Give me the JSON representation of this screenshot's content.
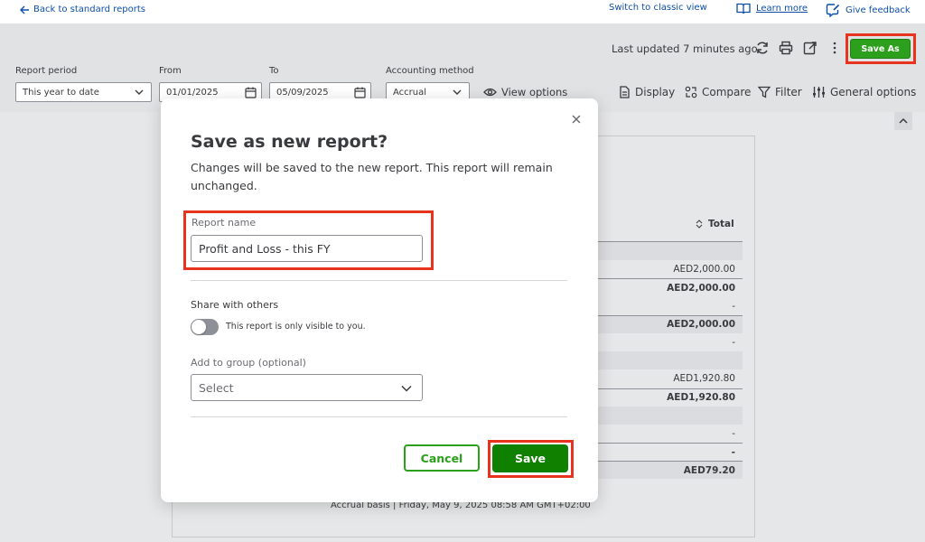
{
  "topbar": {
    "back_label": "Back to standard reports",
    "classic_label": "Switch to classic view",
    "learn_label": "Learn more",
    "feedback_label": "Give feedback"
  },
  "header": {
    "last_updated": "Last updated 7 minutes ago",
    "save_as_label": "Save As"
  },
  "filters": {
    "report_period_label": "Report period",
    "report_period_value": "This year to date",
    "from_label": "From",
    "from_value": "01/01/2025",
    "to_label": "To",
    "to_value": "05/09/2025",
    "method_label": "Accounting method",
    "method_value": "Accrual",
    "view_options_label": "View options"
  },
  "tools": {
    "display_label": "Display",
    "compare_label": "Compare",
    "filter_label": "Filter",
    "general_label": "General options"
  },
  "report": {
    "total_header": "Total",
    "rows": [
      {
        "value": "",
        "style": "band"
      },
      {
        "value": "AED2,000.00",
        "style": "plain"
      },
      {
        "value": "AED2,000.00",
        "style": "bold-topline"
      },
      {
        "value": "-",
        "style": "plain"
      },
      {
        "value": "AED2,000.00",
        "style": "band-bold-topline"
      },
      {
        "value": "-",
        "style": "plain"
      },
      {
        "value": "",
        "style": "band"
      },
      {
        "value": "AED1,920.80",
        "style": "plain"
      },
      {
        "value": "AED1,920.80",
        "style": "bold-topline"
      },
      {
        "value": "",
        "style": "band"
      },
      {
        "value": "-",
        "style": "plain"
      },
      {
        "value": "-",
        "style": "bold-topline"
      },
      {
        "value": "AED79.20",
        "style": "band-bold-topline"
      }
    ],
    "footer": "Accrual basis  |  Friday, May 9, 2025 08:58 AM GMT+02:00"
  },
  "modal": {
    "title": "Save as new report?",
    "description": "Changes will be saved to the new report. This report will remain unchanged.",
    "name_label": "Report name",
    "name_value": "Profit and Loss - this FY",
    "share_label": "Share with others",
    "toggle_label": "This report is only visible to you.",
    "group_label": "Add to group (optional)",
    "group_placeholder": "Select",
    "cancel_label": "Cancel",
    "save_label": "Save"
  },
  "colors": {
    "brand_green": "#2ca01c",
    "save_green": "#108000",
    "highlight_red": "#e8331e",
    "link_blue": "#0d4fa8"
  }
}
